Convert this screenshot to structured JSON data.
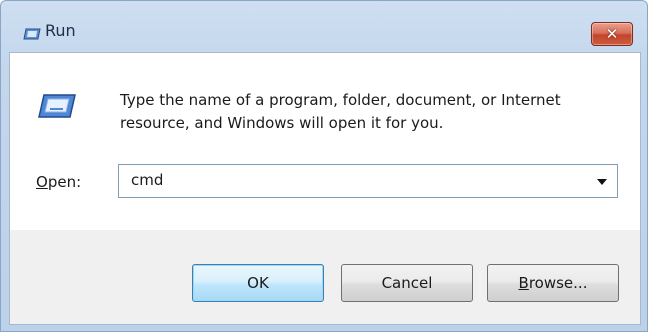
{
  "window": {
    "title": "Run",
    "close_symbol": "✕"
  },
  "icons": {
    "title_icon": "run-icon",
    "large_icon": "run-icon",
    "close_icon": "close-icon",
    "dropdown_icon": "chevron-down-icon"
  },
  "dialog": {
    "description_line1": "Type the name of a program, folder, document, or Internet",
    "description_line2": "resource, and Windows will open it for you.",
    "open_label_mnemonic": "O",
    "open_label_rest": "pen:",
    "open_value": "cmd"
  },
  "buttons": {
    "ok_label": "OK",
    "cancel_label": "Cancel",
    "browse_mnemonic": "B",
    "browse_rest": "rowse..."
  },
  "colors": {
    "titlebar": "#c3d6ec",
    "close_button": "#c2452d",
    "default_button_border": "#3c7fb1"
  }
}
